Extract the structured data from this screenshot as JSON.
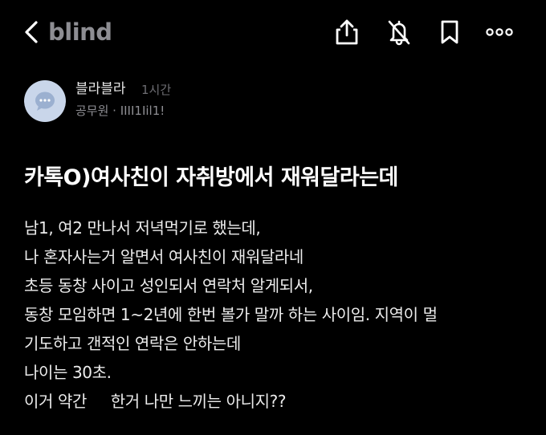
{
  "header": {
    "logo": "blind",
    "back_icon": "chevron-left-icon",
    "share_icon": "share-icon",
    "notification_icon": "bell-off-icon",
    "bookmark_icon": "bookmark-icon",
    "more_icon": "more-horizontal-icon"
  },
  "author": {
    "avatar_icon": "chat-bubble-icon",
    "avatar_color": "#c9d6ea",
    "name": "블라블라",
    "time": "1시간",
    "company": "공무원 · IIII1Iil1!"
  },
  "post": {
    "title": "카톡O)여사친이 자취방에서 재워달라는데",
    "body": [
      "남1, 여2 만나서 저녁먹기로 했는데,",
      "나 혼자사는거 알면서 여사친이 재워달라네",
      "초등 동창 사이고 성인되서 연락처 알게되서,",
      "동창 모임하면 1~2년에 한번 볼가 말까 하는 사이임. 지역이 멀",
      "기도하고 갠적인 연락은 안하는데",
      "나이는 30초.",
      "이거 약간     한거 나만 느끼는 아니지??"
    ]
  },
  "colors": {
    "background": "#000000",
    "text": "#ffffff",
    "muted": "#8e8e93"
  }
}
